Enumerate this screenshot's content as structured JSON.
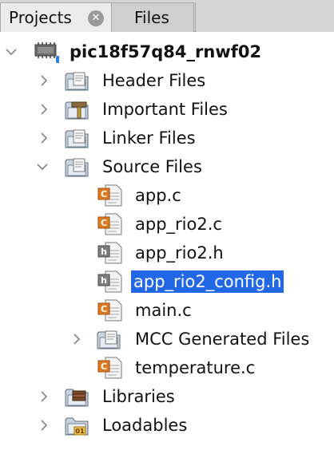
{
  "tabs": {
    "projects_label": "Projects",
    "files_label": "Files"
  },
  "tree": {
    "root": "pic18f57q84_rnwf02",
    "header_files": "Header Files",
    "important_files": "Important Files",
    "linker_files": "Linker Files",
    "source_files": "Source Files",
    "files": {
      "app_c": "app.c",
      "app_rio2_c": "app_rio2.c",
      "app_rio2_h": "app_rio2.h",
      "app_rio2_config_h": "app_rio2_config.h",
      "main_c": "main.c",
      "mcc_generated": "MCC Generated Files",
      "temperature_c": "temperature.c"
    },
    "libraries": "Libraries",
    "loadables": "Loadables",
    "selected_item": "app_rio2_config.h"
  },
  "colors": {
    "selection": "#2268e6",
    "c_file_icon": "#e07a1f",
    "h_file_icon": "#7f7f7f",
    "folder": "#c9d3e0"
  },
  "icons": {
    "project": "chip-project-icon",
    "folder": "folder-icon",
    "important_folder": "important-folder-icon",
    "library_folder": "library-folder-icon",
    "loadables_folder": "loadables-folder-icon",
    "c_file": "c-file-icon",
    "h_file": "h-file-icon"
  }
}
